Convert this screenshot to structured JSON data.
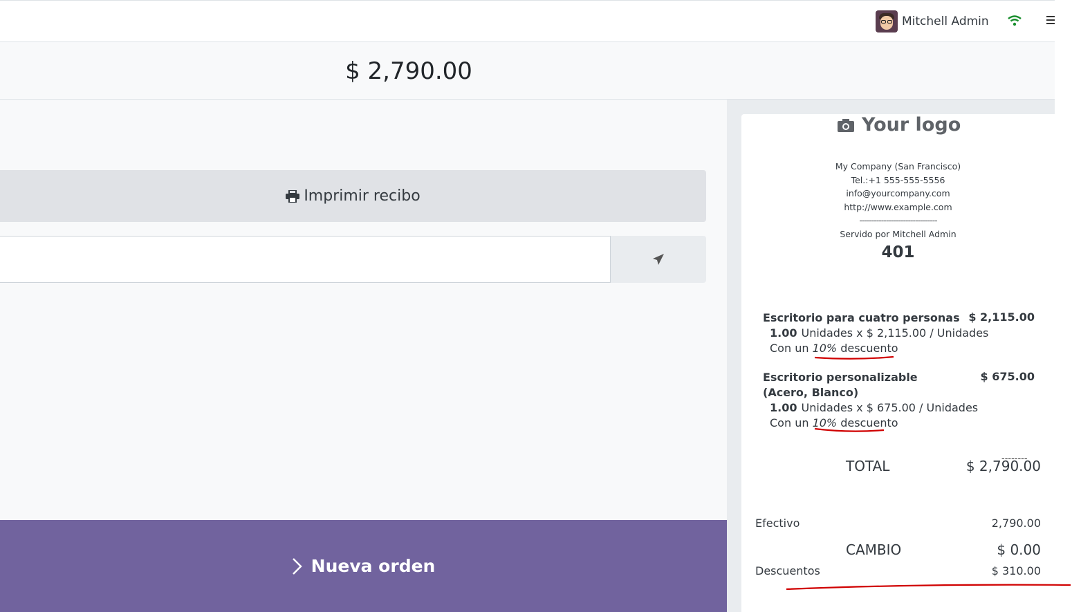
{
  "header": {
    "user_name": "Mitchell Admin",
    "avatar_icon": "user-avatar",
    "wifi_icon": "wifi-icon",
    "menu_icon": "hamburger-menu-icon"
  },
  "amount_due": "$ 2,790.00",
  "actions": {
    "print_label": "Imprimir recibo",
    "print_icon": "printer-icon",
    "email_placeholder": "",
    "send_icon": "send-icon",
    "new_order_label": "Nueva orden",
    "new_order_icon": "chevron-right-icon"
  },
  "receipt": {
    "logo_text": "Your logo",
    "company_name": "My Company (San Francisco)",
    "phone": "Tel.:+1 555-555-5556",
    "email": "info@yourcompany.com",
    "website": "http://www.example.com",
    "separator": "--------------------------------",
    "served_by": "Servido por Mitchell Admin",
    "order_number": "401",
    "lines": [
      {
        "product": "Escritorio para cuatro personas",
        "price": "$ 2,115.00",
        "qty": "1.00",
        "unit_detail": "Unidades x $ 2,115.00 / Unidades",
        "discount_prefix": "Con un",
        "discount_pct": "10%",
        "discount_word": "descuento"
      },
      {
        "product": "Escritorio personalizable (Acero, Blanco)",
        "price": "$ 675.00",
        "qty": "1.00",
        "unit_detail": "Unidades x $ 675.00 / Unidades",
        "discount_prefix": "Con un",
        "discount_pct": "10%",
        "discount_word": "descuento"
      }
    ],
    "subtotal_separator": "--------",
    "total_label": "TOTAL",
    "total_value": "$ 2,790.00",
    "payment_label": "Efectivo",
    "payment_value": "2,790.00",
    "change_label": "CAMBIO",
    "change_value": "$ 0.00",
    "discounts_label": "Descuentos",
    "discounts_value": "$ 310.00"
  },
  "colors": {
    "new_order_bg": "#71639e",
    "annotation_red": "#d00000"
  }
}
